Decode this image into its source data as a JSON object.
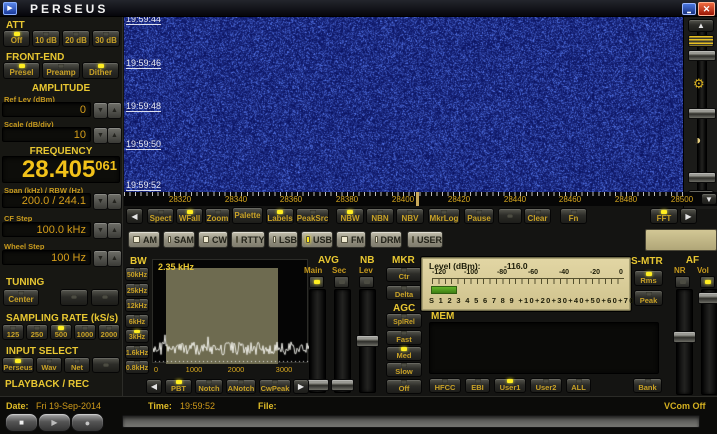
{
  "titlebar": {
    "title": "PERSEUS"
  },
  "icons": {
    "left_arrow": "◀",
    "right_arrow": "▶",
    "up_arrow": "▲",
    "down_arrow": "▼",
    "spin_up": "▲",
    "spin_down": "▼",
    "gear": "⚙",
    "contrast": "◑",
    "stop": "■",
    "play": "▶",
    "record": "●",
    "app": "▶",
    "minimize": "▂",
    "close": "✕"
  },
  "att": {
    "header": "ATT",
    "options": [
      {
        "label": "Off",
        "active": true
      },
      {
        "label": "10 dB",
        "active": false
      },
      {
        "label": "20 dB",
        "active": false
      },
      {
        "label": "30 dB",
        "active": false
      }
    ]
  },
  "front_end": {
    "header": "FRONT-END",
    "options": [
      {
        "label": "Presel",
        "active": true
      },
      {
        "label": "Preamp",
        "active": false
      },
      {
        "label": "Dither",
        "active": true
      }
    ]
  },
  "amplitude": {
    "header": "AMPLITUDE",
    "ref_lev_label": "Ref Lev (dBm)",
    "ref_lev_value": "0",
    "scale_label": "Scale (dB/div)",
    "scale_value": "10"
  },
  "frequency": {
    "header": "FREQUENCY",
    "main": "28.405",
    "fraction": "061"
  },
  "span": {
    "label": "Span (kHz) / RBW (Hz)",
    "value": "200.0 / 244.1"
  },
  "cf_step": {
    "label": "CF Step",
    "value": "100.0 kHz"
  },
  "wheel_step": {
    "label": "Wheel Step",
    "value": "100 Hz"
  },
  "tuning": {
    "header": "TUNING",
    "center_label": "Center"
  },
  "sampling_rate": {
    "header": "SAMPLING RATE (kS/s)",
    "options": [
      {
        "label": "125",
        "active": false
      },
      {
        "label": "250",
        "active": false
      },
      {
        "label": "500",
        "active": true
      },
      {
        "label": "1000",
        "active": false
      },
      {
        "label": "2000",
        "active": false
      }
    ]
  },
  "input_select": {
    "header": "INPUT SELECT",
    "options": [
      {
        "label": "Perseus",
        "active": true
      },
      {
        "label": "Wav",
        "active": false
      },
      {
        "label": "Net",
        "active": false
      }
    ]
  },
  "playback": {
    "header": "PLAYBACK / REC",
    "date_label": "Date:",
    "date_value": "Fri 19-Sep-2014",
    "time_label": "Time:",
    "time_value": "19:59:52",
    "file_label": "File:",
    "vcom_status": "VCom Off"
  },
  "waterfall": {
    "timestamps": [
      "19:59:44",
      "19:59:46",
      "19:59:48",
      "19:59:50",
      "19:59:52"
    ]
  },
  "freq_scale": {
    "labels": [
      "28320",
      "28340",
      "28360",
      "28380",
      "28400",
      "28420",
      "28440",
      "28460",
      "28480",
      "28500"
    ]
  },
  "toolbar": {
    "buttons": [
      {
        "label": "Spect",
        "active": false
      },
      {
        "label": "WFall",
        "active": true
      },
      {
        "label": "Zoom",
        "active": false
      },
      {
        "label": "Palette",
        "active": false
      },
      {
        "label": "Labels",
        "active": true
      },
      {
        "label": "PeakSrc",
        "active": false
      },
      {
        "label": "NBW",
        "active": true
      },
      {
        "label": "NBN",
        "active": false
      },
      {
        "label": "NBV",
        "active": false
      },
      {
        "label": "MkrLog",
        "active": false
      },
      {
        "label": "Pause",
        "active": false
      },
      {
        "label": "Clear",
        "active": false
      },
      {
        "label": "Fn",
        "active": false
      },
      {
        "label": "FFT",
        "active": true
      }
    ]
  },
  "demod": {
    "modes": [
      {
        "label": "AM",
        "active": false
      },
      {
        "label": "SAM",
        "active": false
      },
      {
        "label": "CW",
        "active": false
      },
      {
        "label": "RTTY",
        "active": false
      },
      {
        "label": "LSB",
        "active": false
      },
      {
        "label": "USB",
        "active": true
      },
      {
        "label": "FM",
        "active": false
      },
      {
        "label": "DRM",
        "active": false
      },
      {
        "label": "USER",
        "active": false
      }
    ]
  },
  "bw": {
    "header": "BW",
    "value": "2.35 kHz",
    "filters": [
      {
        "label": "50kHz",
        "active": false
      },
      {
        "label": "25kHz",
        "active": false
      },
      {
        "label": "12kHz",
        "active": false
      },
      {
        "label": "6kHz",
        "active": false
      },
      {
        "label": "3kHz",
        "active": true
      },
      {
        "label": "1.6kHz",
        "active": false
      },
      {
        "label": "0.8kHz",
        "active": false
      }
    ],
    "axis_labels": [
      "0",
      "1000",
      "2000",
      "3000"
    ]
  },
  "avg": {
    "header": "AVG",
    "main_label": "Main",
    "sec_label": "Sec",
    "main_on": true,
    "sec_on": false
  },
  "nb": {
    "header": "NB",
    "lev_label": "Lev",
    "on": false
  },
  "mkr": {
    "header": "MKR",
    "ctr_label": "Ctr",
    "delta_label": "Delta"
  },
  "agc": {
    "header": "AGC",
    "options": [
      {
        "label": "SplRel",
        "active": false
      },
      {
        "label": "Fast",
        "active": false
      },
      {
        "label": "Med",
        "active": true
      },
      {
        "label": "Slow",
        "active": false
      },
      {
        "label": "Off",
        "active": false
      }
    ]
  },
  "meter": {
    "title": "Level (dBm):",
    "value": "-116.0",
    "db_labels": [
      "-120",
      "-100",
      "-80",
      "-60",
      "-40",
      "-20",
      "0"
    ],
    "s_scale": "S 1 2 3 4 5 6 7 8 9 +10+20+30+40+50+60+70"
  },
  "smtr": {
    "header": "S-MTR",
    "rms_label": "Rms",
    "peak_label": "Peak",
    "rms_on": true
  },
  "af": {
    "header": "AF",
    "nr_label": "NR",
    "vol_label": "Vol",
    "nr_on": false,
    "vol_on": true
  },
  "mem": {
    "header": "MEM",
    "buttons": [
      {
        "label": "HFCC",
        "active": false
      },
      {
        "label": "EBI",
        "active": false
      },
      {
        "label": "User1",
        "active": true
      },
      {
        "label": "User2",
        "active": false
      },
      {
        "label": "ALL",
        "active": false
      },
      {
        "label": "Bank",
        "active": false
      }
    ]
  },
  "passband": {
    "buttons": [
      {
        "label": "PBT",
        "active": true
      },
      {
        "label": "Notch",
        "active": false
      },
      {
        "label": "ANotch",
        "active": false
      },
      {
        "label": "CwPeak",
        "active": false
      }
    ]
  },
  "colors": {
    "accent_yellow": "#e8c732",
    "led_on": "#ffee22",
    "waterfall_base": "#0d1a6d",
    "meter_bg": "#d8cb97",
    "meter_green": "#4f9a1d"
  }
}
